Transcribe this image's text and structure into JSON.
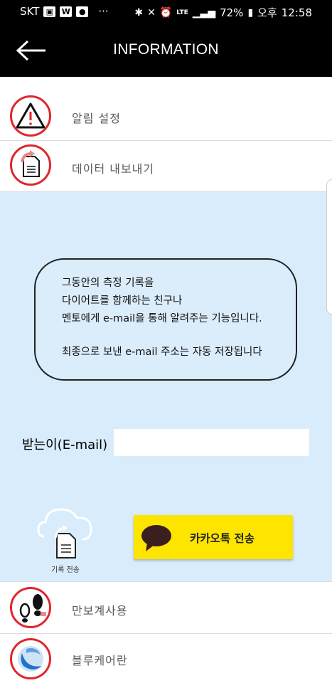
{
  "status_bar": {
    "carrier": "SKT",
    "battery": "72%",
    "time_prefix": "오후",
    "time": "12:58",
    "network": "LTE"
  },
  "header": {
    "title": "INFORMATION",
    "back_icon": "back-arrow-icon"
  },
  "menu_top": [
    {
      "label": "알림 설정",
      "icon": "warning-triangle-icon"
    },
    {
      "label": "데이터 내보내기",
      "icon": "document-export-icon"
    }
  ],
  "info": {
    "lines": [
      "그동안의 측정 기록을",
      "다이어트를 함께하는 친구나",
      "멘토에게 e-mail을 통해 알려주는 기능입니다.",
      "최종으로 보낸 e-mail 주소는 자동 저장됩니다"
    ]
  },
  "email": {
    "label": "받는이(E-mail)",
    "value": ""
  },
  "actions": {
    "upload_label": "기록 전송",
    "kakao_label": "카카오톡 전송"
  },
  "menu_bottom": [
    {
      "label": "만보계사용",
      "icon": "footprints-icon"
    },
    {
      "label": "블루케어란",
      "icon": "bluecare-logo-icon"
    }
  ],
  "colors": {
    "accent_red": "#e0262d",
    "panel_blue": "#d9ecfb",
    "kakao_yellow": "#fee500"
  }
}
